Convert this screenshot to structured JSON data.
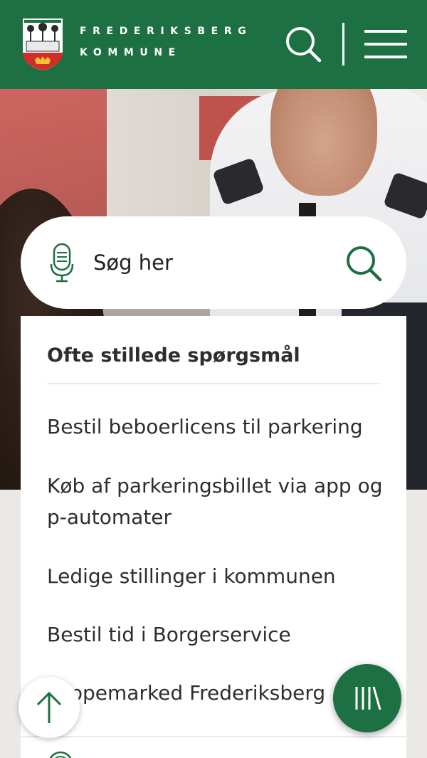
{
  "header": {
    "brand_line1": "FREDERIKSBERG",
    "brand_line2": "KOMMUNE",
    "background_color": "#1c7042",
    "logo_icon": "frederiksberg-coat-of-arms",
    "search_icon": "search-icon",
    "menu_icon": "hamburger-menu-icon"
  },
  "search": {
    "placeholder": "Søg her",
    "voice_icon": "microphone-icon",
    "submit_icon": "search-icon"
  },
  "faq": {
    "title": "Ofte stillede spørgsmål",
    "items": [
      {
        "label": "Bestil beboerlicens til parkering"
      },
      {
        "label": "Køb af parkeringsbillet via app og p-automater"
      },
      {
        "label": "Ledige stillinger i kommunen"
      },
      {
        "label": "Bestil tid i Borgerservice"
      },
      {
        "label": "Loppemarked Frederiksberg"
      }
    ]
  },
  "floating": {
    "back_to_top_icon": "arrow-up-icon",
    "library_icon": "library-icon",
    "accent_color": "#1c7042"
  }
}
